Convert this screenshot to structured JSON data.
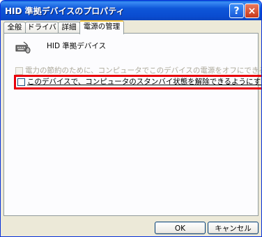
{
  "window": {
    "title": "HID 準拠デバイスのプロパティ",
    "help_label": "?",
    "close_label": "×"
  },
  "tabs": [
    {
      "label": "全般"
    },
    {
      "label": "ドライバ"
    },
    {
      "label": "詳細"
    },
    {
      "label": "電源の管理",
      "active": true
    }
  ],
  "device": {
    "icon": "keyboard-mouse-icon",
    "name": "HID 準拠デバイス"
  },
  "options": [
    {
      "label": "電力の節約のために、コンピュータでこのデバイスの電源をオフにできるようにする",
      "checked": false,
      "enabled": false
    },
    {
      "label": "このデバイスで、コンピュータのスタンバイ状態を解除できるようにする",
      "checked": false,
      "enabled": true,
      "highlighted": true
    }
  ],
  "buttons": {
    "ok_label": "OK",
    "cancel_label": "キャンセル"
  },
  "colors": {
    "titlebar": "#0a4cd0",
    "highlight_border": "#e8000b",
    "active_tab_accent": "#ffc83c"
  }
}
